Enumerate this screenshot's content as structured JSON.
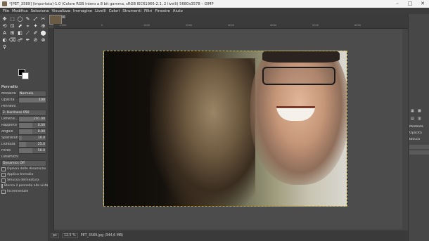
{
  "window": {
    "title": "*[PET_3589] (importata)-1.0 (Colore RGB intero a 8 bit gamma, sRGB IEC61966-2.1, 2 livelli) 5680x3578 – GIMP",
    "controls": [
      "–",
      "□",
      "✕"
    ]
  },
  "menu": [
    "File",
    "Modifica",
    "Seleziona",
    "Visualizza",
    "Immagine",
    "Livelli",
    "Colori",
    "Strumenti",
    "Filtri",
    "Finestre",
    "Aiuto"
  ],
  "tools": [
    "✥",
    "⬚",
    "◯",
    "✎",
    "⤢",
    "✂",
    "⟲",
    "⊡",
    "⬈",
    "⌖",
    "✦",
    "⊕",
    "A",
    "⊞",
    "◧",
    "⟋",
    "✐",
    "⬤",
    "◐",
    "⌫",
    "☍",
    "✒",
    "⊘",
    "⊗",
    "⚲"
  ],
  "colors": {
    "foreground": "#000000",
    "background": "#ffffff"
  },
  "tool_options": {
    "title": "Pennello",
    "mode_label": "Modalità",
    "mode_value": "Normale",
    "opacity_label": "Opacità",
    "opacity_value": "100",
    "brush_label": "Pennello",
    "brush_value": "2. Hardness 050",
    "params": [
      {
        "label": "Dimensi...",
        "value": "201.00",
        "fraction": 0.55
      },
      {
        "label": "Rapporto di...",
        "value": "0.00",
        "fraction": 0.5
      },
      {
        "label": "Angolo",
        "value": "0.00",
        "fraction": 0.5
      },
      {
        "label": "Spaziatura",
        "value": "10.0",
        "fraction": 0.1
      },
      {
        "label": "Durezza",
        "value": "25.0",
        "fraction": 0.25
      },
      {
        "label": "Forza",
        "value": "50.0",
        "fraction": 0.5
      }
    ],
    "dynamics_label": "Dinamiche",
    "dynamics_value": "Dynamics Off",
    "checks": [
      "Opzioni delle dinamiche",
      "Applica tremolio",
      "Smussa delineatura",
      "Blocca il pennello alla vista",
      "Incrementale"
    ]
  },
  "ruler_ticks": [
    "-1000",
    "0",
    "1000",
    "2000",
    "3000",
    "4000",
    "5000",
    "6000"
  ],
  "status": {
    "unit": "px",
    "zoom": "12,5 %",
    "file": "PET_3589.jpg (344,6 MB)"
  },
  "right_dock": {
    "mode_label": "Modalità",
    "opacity_label": "Opacità",
    "lock_label": "Blocca"
  }
}
